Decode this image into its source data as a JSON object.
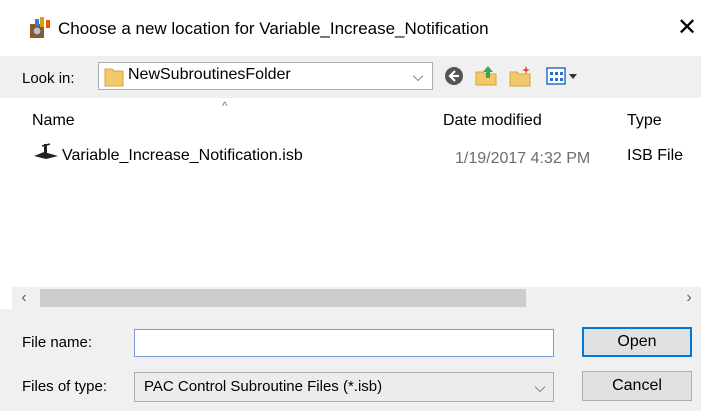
{
  "dialog": {
    "title": "Choose a new location for Variable_Increase_Notification",
    "close_glyph": "✕",
    "app_icon": "pac-control-app-icon"
  },
  "lookin": {
    "label": "Look in:",
    "value": "NewSubroutinesFolder",
    "folder_icon": "folder-icon",
    "arrow": "⌵"
  },
  "toolbar": {
    "icons": [
      "back-icon",
      "up-folder-icon",
      "new-folder-icon",
      "view-menu-icon"
    ]
  },
  "list": {
    "columns": [
      "Name",
      "Date modified",
      "Type"
    ],
    "sort_indicator": "^",
    "rows": [
      {
        "name": "Variable_Increase_Notification.isb",
        "date": "1/19/2017 4:32 PM",
        "type": "ISB File",
        "icon": "isb-file-icon"
      }
    ]
  },
  "scroll": {
    "left": "‹",
    "right": "›"
  },
  "filename": {
    "label": "File name:",
    "value": ""
  },
  "filetype": {
    "label": "Files of type:",
    "value": "PAC Control Subroutine Files (*.isb)",
    "arrow": "⌵"
  },
  "buttons": {
    "open": "Open",
    "cancel": "Cancel"
  },
  "colors": {
    "accent": "#0078d7",
    "folder": "#f3c86b"
  }
}
